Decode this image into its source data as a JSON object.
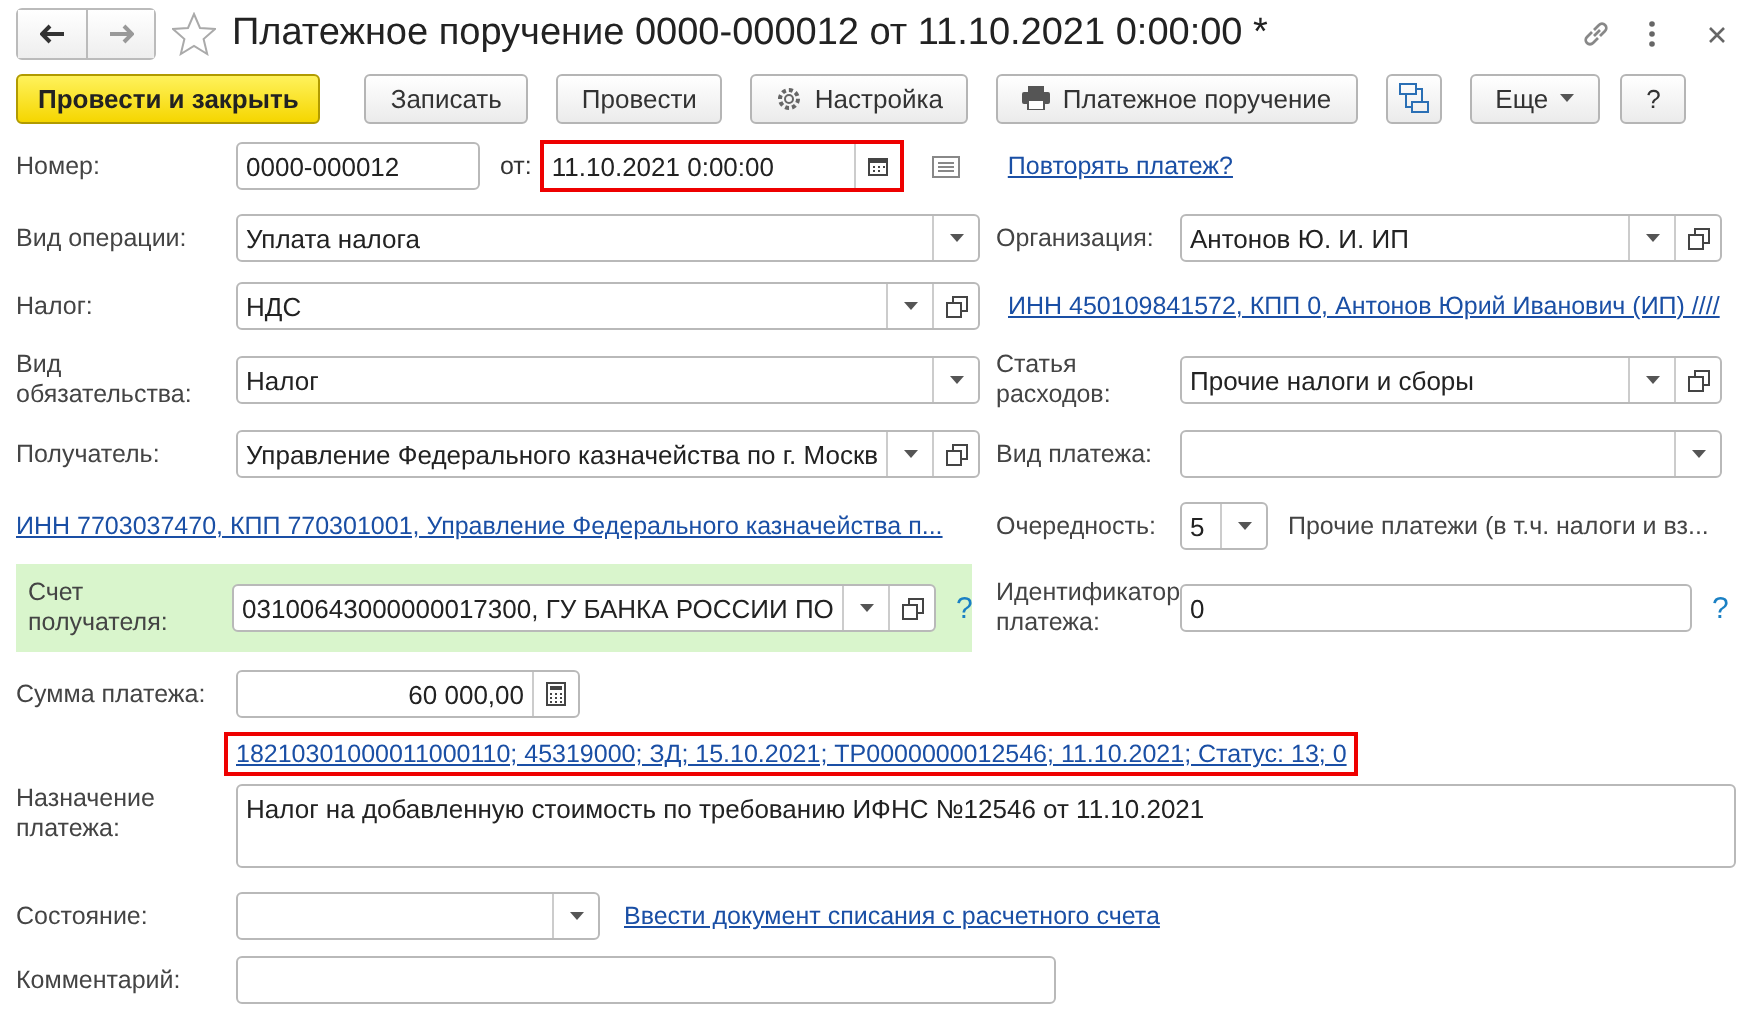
{
  "window": {
    "title": "Платежное поручение 0000-000012 от 11.10.2021 0:00:00 *"
  },
  "toolbar": [
    {
      "kind": "primary",
      "label": "Провести и закрыть"
    },
    {
      "kind": "plain",
      "label": "Записать"
    },
    {
      "kind": "plain",
      "label": "Провести"
    },
    {
      "kind": "gear",
      "label": "Настройка"
    },
    {
      "kind": "printer",
      "label": "Платежное поручение"
    },
    {
      "kind": "structure"
    },
    {
      "kind": "menu",
      "label": "Еще"
    },
    {
      "kind": "plain",
      "label": "?"
    }
  ],
  "number": {
    "label": "Номер:",
    "value": "0000-000012",
    "date_label": "от:",
    "date": "11.10.2021  0:00:00",
    "date_highlighted": true,
    "repeat_link": "Повторять платеж?"
  },
  "left": [
    {
      "kind": "select",
      "label": "Вид операции:",
      "value": "Уплата налога",
      "open_button": false
    },
    {
      "kind": "select",
      "label": "Налог:",
      "value": "НДС",
      "open_button": true
    },
    {
      "kind": "select",
      "label": "Вид обязательства:",
      "value": "Налог",
      "open_button": false
    },
    {
      "kind": "select",
      "label": "Получатель:",
      "value": "Управление Федерального казначейства по г. Москв",
      "open_button": true
    },
    {
      "kind": "link",
      "value": "ИНН 7703037470, КПП 770301001, Управление Федерального казначейства п..."
    },
    {
      "kind": "select",
      "label": "Счет получателя:",
      "value": "03100643000000017300, ГУ БАНКА РОССИИ ПО",
      "open_button": true,
      "highlighted": true,
      "help": "?"
    }
  ],
  "right": [
    {
      "kind": "select",
      "label": "Организация:",
      "value": "Антонов Ю. И. ИП",
      "open_button": true
    },
    {
      "kind": "link",
      "value": "ИНН 450109841572, КПП 0, Антонов Юрий Иванович (ИП) ////"
    },
    {
      "kind": "select",
      "label": "Статья расходов:",
      "value": "Прочие налоги и сборы",
      "open_button": true
    },
    {
      "kind": "select",
      "label": "Вид платежа:",
      "open_button": false
    },
    {
      "kind": "priority",
      "label": "Очередность:",
      "value": "5",
      "description": "Прочие платежи (в т.ч. налоги и вз..."
    },
    {
      "kind": "input",
      "label": "Идентификатор платежа:",
      "value": "0",
      "help": "?"
    }
  ],
  "bottom": [
    {
      "kind": "amount",
      "label": "Сумма платежа:",
      "value": "60 000,00"
    },
    {
      "kind": "link",
      "value": "18210301000011000110; 45319000; ЗД; 15.10.2021; ТР0000000012546; 11.10.2021; Статус: 13; 0",
      "highlighted": true
    },
    {
      "kind": "textarea",
      "label": "Назначение платежа:",
      "value": "Налог на добавленную стоимость по требованию ИФНС №12546 от 11.10.2021"
    },
    {
      "kind": "select",
      "label": "Состояние:",
      "link": "Ввести документ списания с расчетного счета"
    },
    {
      "kind": "input",
      "label": "Комментарий:"
    }
  ]
}
